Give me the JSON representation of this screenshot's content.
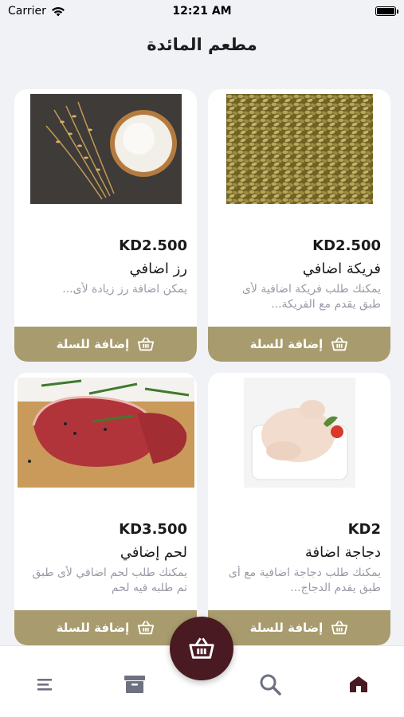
{
  "status_bar": {
    "carrier": "Carrier",
    "time": "12:21 AM"
  },
  "header": {
    "title": "مطعم المائدة"
  },
  "products": [
    {
      "price": "KD2.500",
      "name": "فريكة اضافي",
      "description": "يمكنك طلب فريكة اضافية لأى طبق يقدم مع الفريكة...",
      "button_label": "إضافة للسلة",
      "image": "freekeh-grains"
    },
    {
      "price": "KD2.500",
      "name": "رز اضافي",
      "description": "يمكن اضافة رز زيادة لأى...",
      "button_label": "إضافة للسلة",
      "image": "rice-bowl"
    },
    {
      "price": "KD2",
      "name": "دجاجة اضافة",
      "description": "يمكنك طلب دجاجة اضافية مع أى طبق يقدم الدجاج...",
      "button_label": "إضافة للسلة",
      "image": "raw-chicken"
    },
    {
      "price": "KD3.500",
      "name": "لحم إضافي",
      "description": "يمكنك طلب لحم اضافي لأى طبق تم طلبه فيه لحم",
      "button_label": "إضافة للسلة",
      "image": "raw-beef"
    }
  ],
  "tab_bar": {
    "items": [
      "home-icon",
      "search-icon",
      "cart-icon",
      "orders-icon",
      "menu-icon"
    ]
  },
  "colors": {
    "accent": "#a89b6e",
    "fab": "#4a1a22",
    "home_active": "#4a1a22",
    "inactive": "#6e7180"
  }
}
